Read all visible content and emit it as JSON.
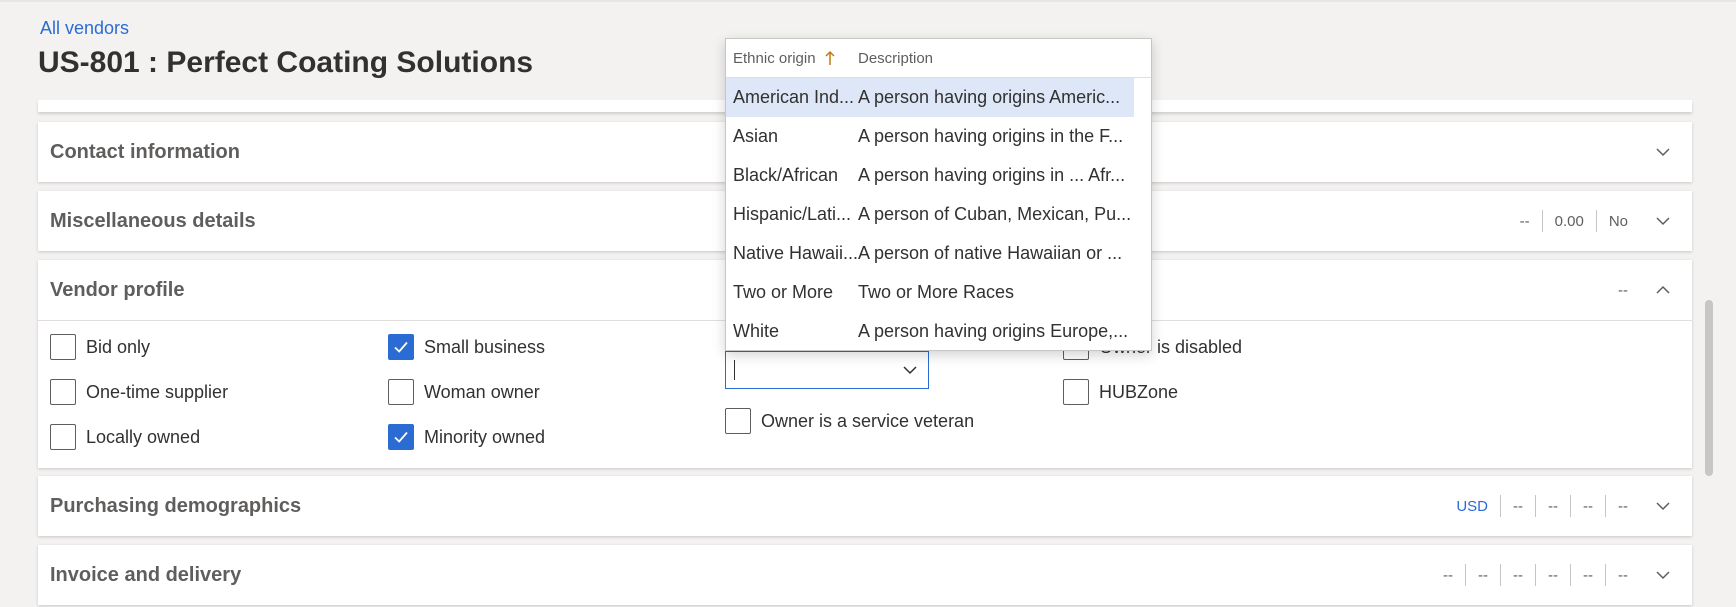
{
  "breadcrumb": "All vendors",
  "page_title": "US-801 : Perfect Coating Solutions",
  "sections": {
    "contact": {
      "title": "Contact information"
    },
    "misc": {
      "title": "Miscellaneous details",
      "summary": [
        "--",
        "0.00",
        "No"
      ]
    },
    "profile": {
      "title": "Vendor profile",
      "summary": [
        "--"
      ]
    },
    "purchasing": {
      "title": "Purchasing demographics",
      "currency": "USD",
      "summary": [
        "--",
        "--",
        "--",
        "--"
      ]
    },
    "invoice": {
      "title": "Invoice and delivery",
      "summary": [
        "--",
        "--",
        "--",
        "--",
        "--",
        "--"
      ]
    }
  },
  "checkboxes": {
    "bid_only": {
      "label": "Bid only",
      "checked": false
    },
    "one_time": {
      "label": "One-time supplier",
      "checked": false
    },
    "locally_owned": {
      "label": "Locally owned",
      "checked": false
    },
    "small_business": {
      "label": "Small business",
      "checked": true
    },
    "woman_owner": {
      "label": "Woman owner",
      "checked": false
    },
    "minority_owned": {
      "label": "Minority owned",
      "checked": true
    },
    "service_veteran": {
      "label": "Owner is a service veteran",
      "checked": false
    },
    "owner_disabled": {
      "label": "Owner is disabled",
      "checked": false
    },
    "hubzone": {
      "label": "HUBZone",
      "checked": false
    }
  },
  "ethnic_origin_field": {
    "value": ""
  },
  "dropdown": {
    "col1_header": "Ethnic origin",
    "col2_header": "Description",
    "rows": [
      {
        "origin": "American Ind...",
        "description": "A person having origins Americ...",
        "selected": true
      },
      {
        "origin": "Asian",
        "description": "A person having origins in the F..."
      },
      {
        "origin": "Black/African",
        "description": "A person having origins in ... Afr..."
      },
      {
        "origin": "Hispanic/Lati...",
        "description": "A person of Cuban, Mexican, Pu..."
      },
      {
        "origin": "Native Hawaii...",
        "description": "A person of native Hawaiian or ..."
      },
      {
        "origin": "Two or More",
        "description": "Two or More Races"
      },
      {
        "origin": "White",
        "description": "A person having origins Europe,..."
      }
    ]
  },
  "colors": {
    "accent": "#2b6cd4",
    "selected_row": "#dde7f8",
    "background": "#f3f2f1"
  }
}
